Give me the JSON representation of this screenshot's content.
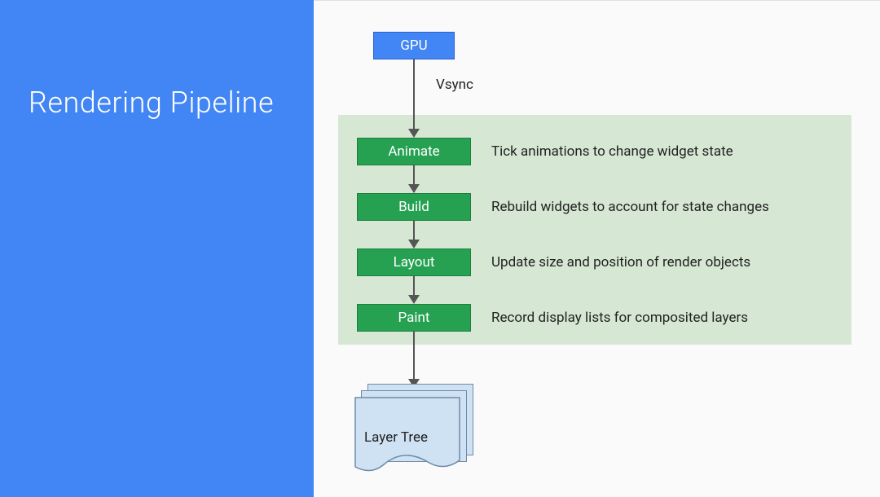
{
  "sidebar": {
    "title": "Rendering Pipeline"
  },
  "top_node": {
    "label": "GPU",
    "edge_label": "Vsync"
  },
  "stages": [
    {
      "name": "Animate",
      "desc": "Tick animations to change widget state"
    },
    {
      "name": "Build",
      "desc": "Rebuild widgets to account for state changes"
    },
    {
      "name": "Layout",
      "desc": "Update size and position of render objects"
    },
    {
      "name": "Paint",
      "desc": "Record display lists for composited layers"
    }
  ],
  "output_node": {
    "label": "Layer Tree"
  }
}
